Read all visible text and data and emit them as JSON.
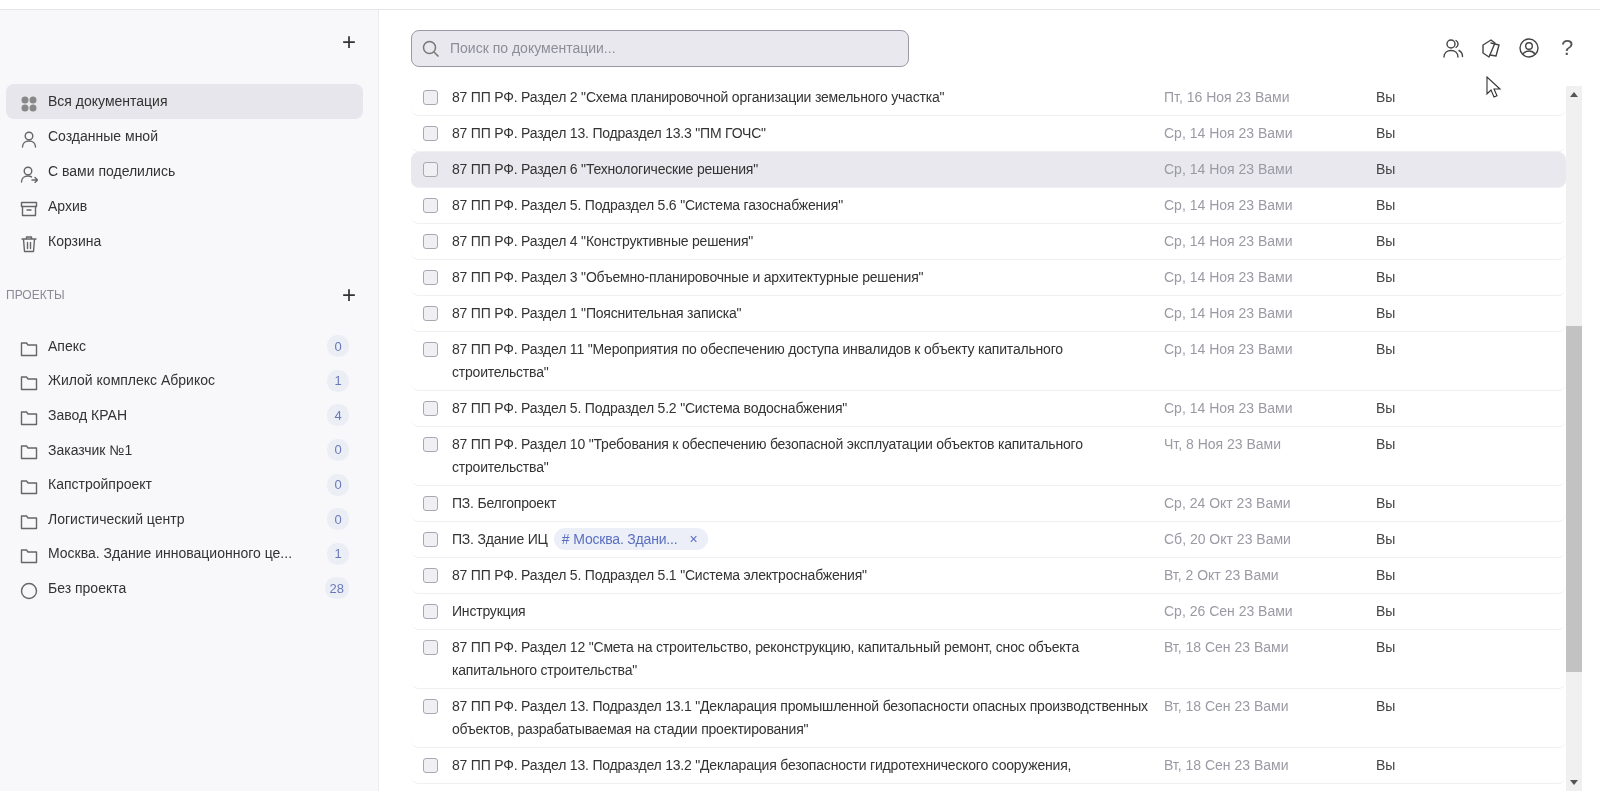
{
  "sidebar": {
    "add_label": "+",
    "nav": [
      {
        "label": "Вся документация",
        "selected": true
      },
      {
        "label": "Созданные мной",
        "selected": false
      },
      {
        "label": "С вами поделились",
        "selected": false
      },
      {
        "label": "Архив",
        "selected": false
      },
      {
        "label": "Корзина",
        "selected": false
      }
    ],
    "projects_heading": "ПРОЕКТЫ",
    "projects_add_label": "+",
    "projects": [
      {
        "name": "Апекс",
        "count": "0",
        "kind": "folder"
      },
      {
        "name": "Жилой комплекс Абрикос",
        "count": "1",
        "kind": "folder"
      },
      {
        "name": "Завод КРАН",
        "count": "4",
        "kind": "folder"
      },
      {
        "name": "Заказчик №1",
        "count": "0",
        "kind": "folder"
      },
      {
        "name": "Капстройпроект",
        "count": "0",
        "kind": "folder"
      },
      {
        "name": "Логистический центр",
        "count": "0",
        "kind": "folder"
      },
      {
        "name": "Москва. Здание инновационного це...",
        "count": "1",
        "kind": "folder"
      },
      {
        "name": "Без проекта",
        "count": "28",
        "kind": "none"
      }
    ]
  },
  "search": {
    "placeholder": "Поиск по документации..."
  },
  "header_help": "?",
  "documents": [
    {
      "title": "87 ПП РФ. Раздел 2 \"Схема планировочной организации земельного участка\"",
      "date": "Пт, 16 Ноя 23 Вами",
      "owner": "Вы",
      "checked": false,
      "highlighted": false
    },
    {
      "title": "87 ПП РФ. Раздел 13. Подраздел 13.3 \"ПМ ГОЧС\"",
      "date": "Ср, 14 Ноя 23 Вами",
      "owner": "Вы",
      "checked": false,
      "highlighted": false
    },
    {
      "title": "87 ПП РФ. Раздел 6 \"Технологические решения\"",
      "date": "Ср, 14 Ноя 23 Вами",
      "owner": "Вы",
      "checked": false,
      "highlighted": true
    },
    {
      "title": "87 ПП РФ. Раздел 5. Подраздел 5.6 \"Система газоснабжения\"",
      "date": "Ср, 14 Ноя 23 Вами",
      "owner": "Вы",
      "checked": false,
      "highlighted": false
    },
    {
      "title": "87 ПП РФ. Раздел 4 \"Конструктивные решения\"",
      "date": "Ср, 14 Ноя 23 Вами",
      "owner": "Вы",
      "checked": false,
      "highlighted": false
    },
    {
      "title": "87 ПП РФ. Раздел 3 \"Объемно-планировочные и архитектурные решения\"",
      "date": "Ср, 14 Ноя 23 Вами",
      "owner": "Вы",
      "checked": false,
      "highlighted": false
    },
    {
      "title": "87 ПП РФ. Раздел 1 \"Пояснительная записка\"",
      "date": "Ср, 14 Ноя 23 Вами",
      "owner": "Вы",
      "checked": false,
      "highlighted": false
    },
    {
      "title": "87 ПП РФ. Раздел 11 \"Мероприятия по обеспечению доступа инвалидов к объекту капитального строительства\"",
      "date": "Ср, 14 Ноя 23 Вами",
      "owner": "Вы",
      "checked": false,
      "highlighted": false
    },
    {
      "title": "87 ПП РФ. Раздел 5. Подраздел 5.2 \"Система водоснабжения\"",
      "date": "Ср, 14 Ноя 23 Вами",
      "owner": "Вы",
      "checked": false,
      "highlighted": false
    },
    {
      "title": "87 ПП РФ. Раздел 10 \"Требования к обеспечению безопасной эксплуатации объектов капитального строительства\"",
      "date": "Чт, 8 Ноя 23 Вами",
      "owner": "Вы",
      "checked": false,
      "highlighted": false
    },
    {
      "title": "ПЗ. Белгопроект",
      "date": "Ср, 24 Окт 23 Вами",
      "owner": "Вы",
      "checked": false,
      "highlighted": false
    },
    {
      "title": "ПЗ. Здание ИЦ",
      "tag": "Москва. Здани...",
      "tag_mark": "#",
      "tag_remove": "×",
      "date": "Сб, 20 Окт 23 Вами",
      "owner": "Вы",
      "checked": false,
      "highlighted": false
    },
    {
      "title": "87 ПП РФ. Раздел 5. Подраздел 5.1 \"Система электроснабжения\"",
      "date": "Вт, 2 Окт 23 Вами",
      "owner": "Вы",
      "checked": false,
      "highlighted": false
    },
    {
      "title": "Инструкция",
      "date": "Ср, 26 Сен 23 Вами",
      "owner": "Вы",
      "checked": false,
      "highlighted": false
    },
    {
      "title": "87 ПП РФ. Раздел 12 \"Смета на строительство, реконструкцию, капитальный ремонт, снос объекта капитального строительства\"",
      "date": "Вт, 18 Сен 23 Вами",
      "owner": "Вы",
      "checked": false,
      "highlighted": false
    },
    {
      "title": "87 ПП РФ. Раздел 13. Подраздел 13.1 \"Декларация промышленной безопасности опасных производственных объектов, разрабатываемая на стадии проектирования\"",
      "date": "Вт, 18 Сен 23 Вами",
      "owner": "Вы",
      "checked": false,
      "highlighted": false
    },
    {
      "title": "87 ПП РФ. Раздел 13. Подраздел 13.2 \"Декларация безопасности гидротехнического сооружения,",
      "date": "Вт, 18 Сен 23 Вами",
      "owner": "Вы",
      "checked": false,
      "highlighted": false
    }
  ]
}
